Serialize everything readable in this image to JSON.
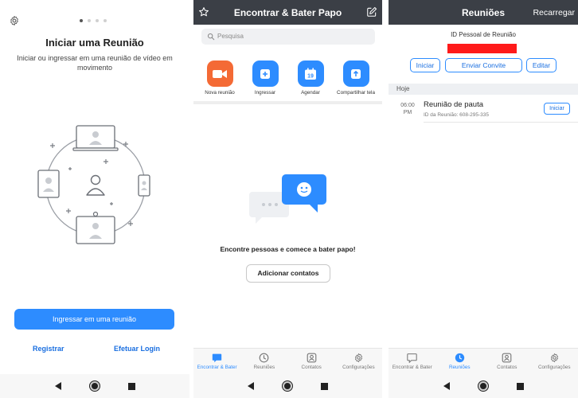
{
  "screen1": {
    "title": "Iniciar uma Reunião",
    "subtitle": "Iniciar ou ingressar em uma reunião de vídeo em movimento",
    "join_button": "Ingressar em uma reunião",
    "register_link": "Registrar",
    "login_link": "Efetuar Login",
    "carousel_pages": 4,
    "carousel_active": 1
  },
  "screen2": {
    "header_title": "Encontrar & Bater Papo",
    "search_placeholder": "Pesquisa",
    "actions": [
      {
        "label": "Nova reunião",
        "icon": "video-camera-icon",
        "color": "#f46a35"
      },
      {
        "label": "Ingressar",
        "icon": "plus-icon",
        "color": "#2d8cff"
      },
      {
        "label": "Agendar",
        "icon": "calendar-icon",
        "color": "#2d8cff",
        "calendar_day": "19"
      },
      {
        "label": "Compartilhar tela",
        "icon": "share-screen-icon",
        "color": "#2d8cff"
      }
    ],
    "empty_message": "Encontre pessoas e comece a bater papo!",
    "add_contacts_button": "Adicionar contatos"
  },
  "screen3": {
    "header_title": "Reuniões",
    "reload_label": "Recarregar",
    "personal_id_label": "ID Pessoal de Reunião",
    "start_button": "Iniciar",
    "invite_button": "Enviar Convite",
    "edit_button": "Editar",
    "today_label": "Hoje",
    "meeting": {
      "time": "06:00",
      "ampm": "PM",
      "title": "Reunião de pauta",
      "id_text": "ID da Reunião: 608-295-335",
      "start_label": "Iniciar"
    }
  },
  "tabs": [
    {
      "label": "Encontrar & Bater",
      "icon": "chat-bubble-icon"
    },
    {
      "label": "Reuniões",
      "icon": "clock-icon"
    },
    {
      "label": "Contatos",
      "icon": "contacts-icon"
    },
    {
      "label": "Configurações",
      "icon": "gear-icon"
    }
  ],
  "colors": {
    "accent": "#2d8cff",
    "orange": "#f46a35",
    "header_dark": "#3b3f46",
    "redaction": "#ff1a1a"
  }
}
